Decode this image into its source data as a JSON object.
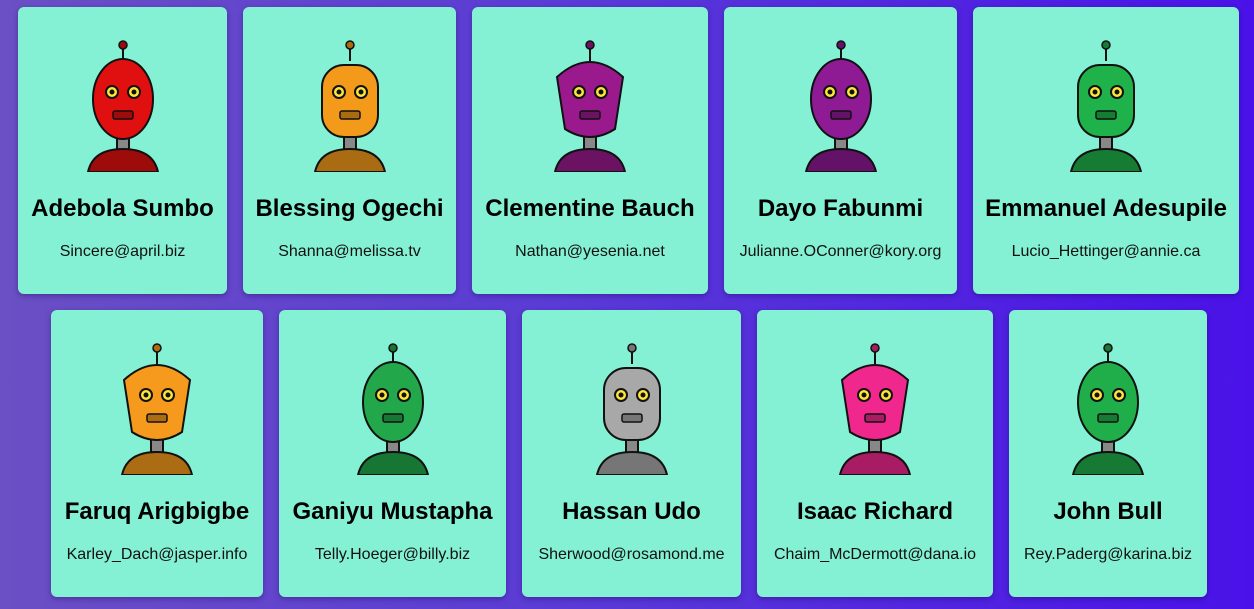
{
  "robots": [
    {
      "name": "Adebola Sumbo",
      "email": "Sincere@april.biz",
      "color": "#e01010",
      "icon": "robot-avatar-red"
    },
    {
      "name": "Blessing Ogechi",
      "email": "Shanna@melissa.tv",
      "color": "#f39a1a",
      "icon": "robot-avatar-orange"
    },
    {
      "name": "Clementine Bauch",
      "email": "Nathan@yesenia.net",
      "color": "#9a1a8e",
      "icon": "robot-avatar-purple"
    },
    {
      "name": "Dayo Fabunmi",
      "email": "Julianne.OConner@kory.org",
      "color": "#8e1a94",
      "icon": "robot-avatar-purple"
    },
    {
      "name": "Emmanuel Adesupile",
      "email": "Lucio_Hettinger@annie.ca",
      "color": "#1fb14a",
      "icon": "robot-avatar-green"
    },
    {
      "name": "Faruq Arigbigbe",
      "email": "Karley_Dach@jasper.info",
      "color": "#f59a1c",
      "icon": "robot-avatar-orange"
    },
    {
      "name": "Ganiyu Mustapha",
      "email": "Telly.Hoeger@billy.biz",
      "color": "#22a84a",
      "icon": "robot-avatar-green"
    },
    {
      "name": "Hassan Udo",
      "email": "Sherwood@rosamond.me",
      "color": "#a8a8a8",
      "icon": "robot-avatar-grey"
    },
    {
      "name": "Isaac Richard",
      "email": "Chaim_McDermott@dana.io",
      "color": "#f0288e",
      "icon": "robot-avatar-pink"
    },
    {
      "name": "John Bull",
      "email": "Rey.Paderg@karina.biz",
      "color": "#1fae4a",
      "icon": "robot-avatar-green"
    }
  ]
}
